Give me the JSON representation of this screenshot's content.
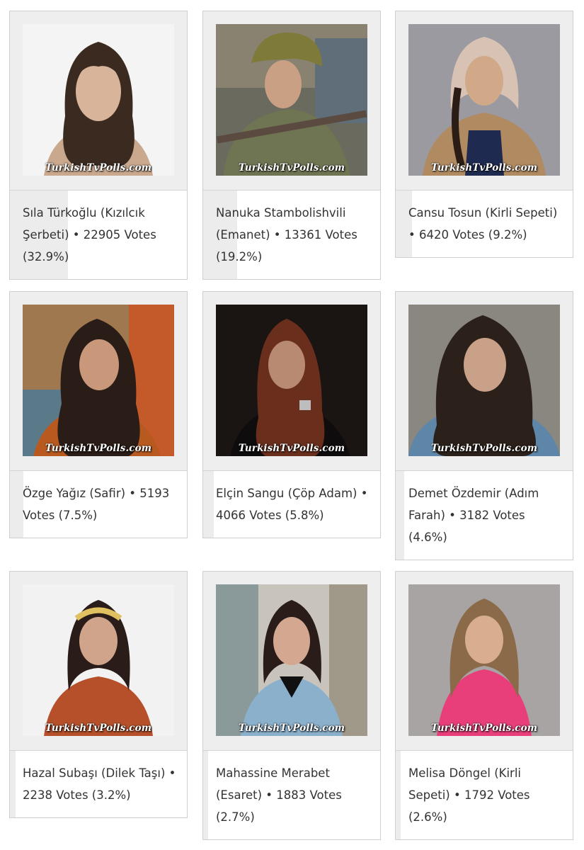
{
  "watermark": "TurkishTvPolls.com",
  "colors": {
    "card_border": "#cfcfcf",
    "photo_background": "#eeeeee",
    "result_bar": "#ececec",
    "text": "#333333"
  },
  "cards": [
    {
      "text": "Sıla Türkoğlu (Kızılcık Şerbeti) • 22905 Votes (32.9%)",
      "percent": 32.9
    },
    {
      "text": "Nanuka Stambolishvili (Emanet) • 13361 Votes (19.2%)",
      "percent": 19.2
    },
    {
      "text": "Cansu Tosun (Kirli Sepeti) • 6420 Votes (9.2%)",
      "percent": 9.2
    },
    {
      "text": "Özge Yağız (Safir) • 5193 Votes (7.5%)",
      "percent": 7.5
    },
    {
      "text": "Elçin Sangu (Çöp Adam) • 4066 Votes (5.8%)",
      "percent": 5.8
    },
    {
      "text": "Demet Özdemir (Adım Farah) • 3182 Votes (4.6%)",
      "percent": 4.6
    },
    {
      "text": "Hazal Subaşı (Dilek Taşı) • 2238 Votes (3.2%)",
      "percent": 3.2
    },
    {
      "text": "Mahassine Merabet (Esaret) • 1883 Votes (2.7%)",
      "percent": 2.7
    },
    {
      "text": "Melisa Döngel (Kirli Sepeti) • 1792 Votes (2.6%)",
      "percent": 2.6
    }
  ]
}
